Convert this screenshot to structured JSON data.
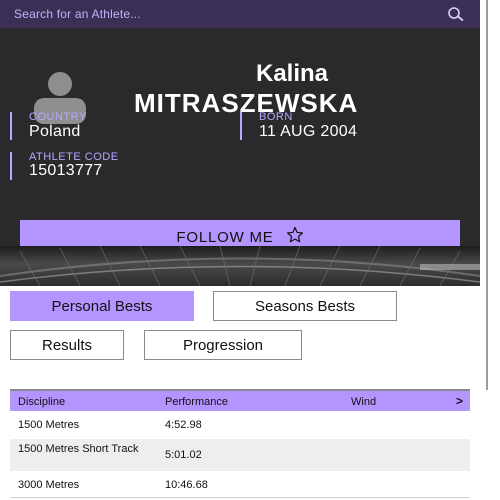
{
  "search": {
    "placeholder": "Search for an Athlete..."
  },
  "athlete": {
    "first_name": "Kalina",
    "last_name": "MITRASZEWSKA",
    "country_label": "COUNTRY",
    "country": "Poland",
    "born_label": "BORN",
    "born": "11 AUG 2004",
    "code_label": "ATHLETE CODE",
    "code": "15013777"
  },
  "follow": {
    "label": "FOLLOW ME"
  },
  "tabs": [
    {
      "label": "Personal Bests",
      "active": true
    },
    {
      "label": "Seasons Bests",
      "active": false
    },
    {
      "label": "Results",
      "active": false
    },
    {
      "label": "Progression",
      "active": false
    }
  ],
  "table": {
    "headers": {
      "discipline": "Discipline",
      "performance": "Performance",
      "wind": "Wind",
      "more": ">"
    },
    "rows": [
      {
        "discipline": "1500 Metres",
        "performance": "4:52.98",
        "wind": ""
      },
      {
        "discipline": "1500 Metres Short Track",
        "performance": "5:01.02",
        "wind": ""
      },
      {
        "discipline": "3000 Metres",
        "performance": "10:46.68",
        "wind": ""
      }
    ]
  },
  "colors": {
    "accent": "#b495ff",
    "card_bg": "#2a2a2c",
    "search_bg": "#3b2f55"
  }
}
